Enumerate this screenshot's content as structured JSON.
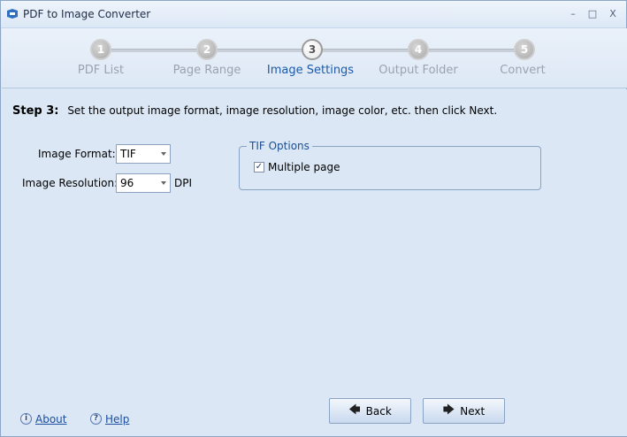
{
  "window": {
    "title": "PDF to Image Converter",
    "controls": {
      "minimize": "–",
      "maximize": "□",
      "close": "X"
    }
  },
  "wizard": {
    "steps": [
      {
        "number": "1",
        "label": "PDF List",
        "active": false
      },
      {
        "number": "2",
        "label": "Page Range",
        "active": false
      },
      {
        "number": "3",
        "label": "Image Settings",
        "active": true
      },
      {
        "number": "4",
        "label": "Output Folder",
        "active": false
      },
      {
        "number": "5",
        "label": "Convert",
        "active": false
      }
    ]
  },
  "content": {
    "step_heading": "Step 3:",
    "step_description": "Set the output image format, image resolution, image color, etc. then click Next.",
    "image_format": {
      "label": "Image Format:",
      "value": "TIF"
    },
    "image_resolution": {
      "label": "Image Resolution:",
      "value": "96",
      "unit": "DPI"
    },
    "tif_options": {
      "title": "TIF Options",
      "multiple_page": {
        "label": "Multiple page",
        "checked": true
      }
    }
  },
  "footer": {
    "about_label": "About",
    "help_label": "Help",
    "back_label": "Back",
    "next_label": "Next"
  },
  "colors": {
    "background": "#dbe7f5",
    "active_step": "#1b5aa8",
    "inactive_step": "#9aa3ad",
    "link": "#1c4ea0"
  }
}
